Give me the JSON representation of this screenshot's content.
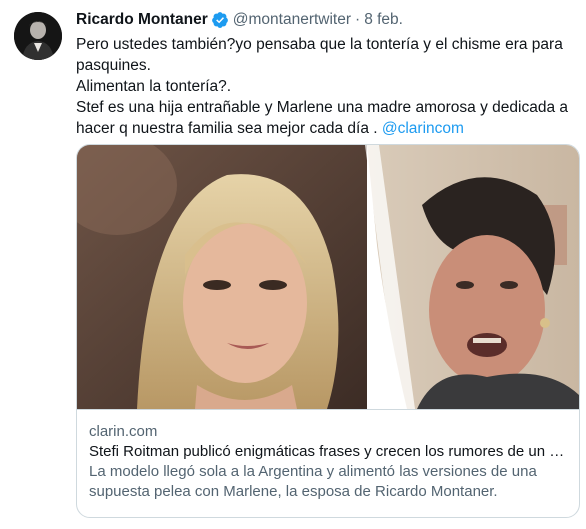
{
  "author": {
    "name": "Ricardo Montaner",
    "handle": "@montanertwiter",
    "separator": "·",
    "date": "8 feb."
  },
  "tweet": {
    "line1": "Pero ustedes también?yo pensaba que la tontería y el chisme era para",
    "line2": "pasquines.",
    "line3": "Alimentan la tontería?.",
    "line4": "Stef es una hija entrañable y Marlene una madre amorosa y dedicada a",
    "line5": "hacer q nuestra familia sea mejor cada día .",
    "mention": "@clarincom"
  },
  "card": {
    "domain": "clarin.com",
    "title": "Stefi Roitman publicó enigmáticas frases y crecen los rumores de un e…",
    "desc_line1": "La modelo llegó sola a la Argentina y alimentó las versiones de una",
    "desc_line2": "supuesta pelea con Marlene, la esposa de Ricardo Montaner."
  },
  "colors": {
    "accent": "#1d9bf0",
    "text": "#0f1419",
    "secondary": "#536471",
    "border": "#cfd9de"
  },
  "icons": {
    "verified": "verified-badge-icon"
  }
}
